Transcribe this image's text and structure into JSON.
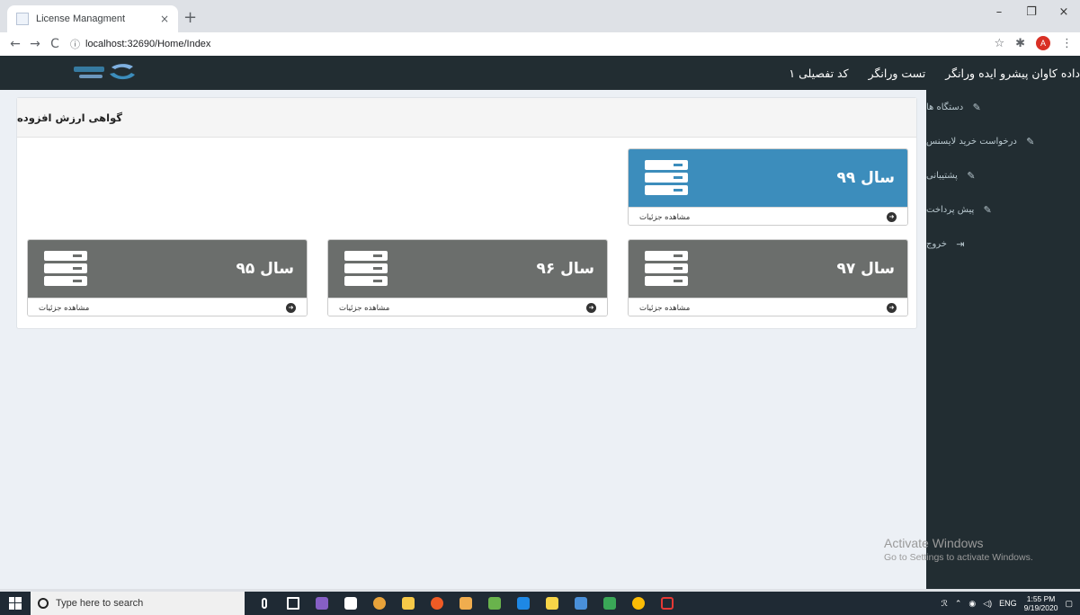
{
  "browser": {
    "tab_title": "License Managment",
    "tab_close": "×",
    "new_tab": "+",
    "url": "localhost:32690/Home/Index",
    "window_controls": [
      "–",
      "❐",
      "×"
    ],
    "avatar_initial": "A"
  },
  "navbar": {
    "links": [
      "داده کاوان پیشرو ایده ورانگر",
      "تست ورانگر",
      "کد تفصیلی ۱"
    ]
  },
  "sidebar": {
    "items": [
      {
        "label": "دستگاه ها",
        "icon": "edit-icon"
      },
      {
        "label": "درخواست خرید لایسنس",
        "icon": "edit-icon"
      },
      {
        "label": "پشتیبانی",
        "icon": "edit-icon"
      },
      {
        "label": "پیش پرداخت",
        "icon": "edit-icon"
      },
      {
        "label": "خروج",
        "icon": "sign-out-icon"
      }
    ]
  },
  "panel": {
    "title": "گواهی ارزش افزوده",
    "cards": [
      {
        "year": "سال ۹۹",
        "details": "مشاهده جزئیات",
        "color": "#3c8dbc"
      },
      {
        "year": "سال ۹۷",
        "details": "مشاهده جزئیات",
        "color": "#6b6e6c"
      },
      {
        "year": "سال ۹۶",
        "details": "مشاهده جزئیات",
        "color": "#6b6e6c"
      },
      {
        "year": "سال ۹۵",
        "details": "مشاهده جزئیات",
        "color": "#6b6e6c"
      }
    ]
  },
  "watermark": {
    "line1": "Activate Windows",
    "line2": "Go to Settings to activate Windows."
  },
  "taskbar": {
    "search_placeholder": "Type here to search",
    "lang": "ENG",
    "time": "1:55 PM",
    "date": "9/19/2020"
  }
}
